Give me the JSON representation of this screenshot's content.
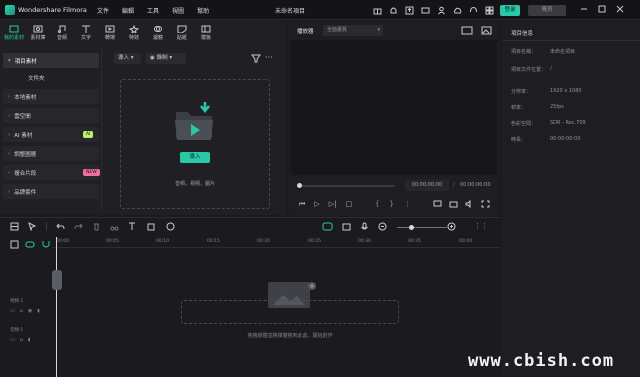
{
  "app_title": "Wondershare Filmora",
  "project_name": "未命名項目",
  "menu": [
    "文件",
    "編輯",
    "工具",
    "視圖",
    "幫助"
  ],
  "login_label": "登录",
  "buy_label": "購買",
  "tabs": [
    "我的素材",
    "素材庫",
    "音頻",
    "文字",
    "轉場",
    "特效",
    "濾鏡",
    "貼紙",
    "模板"
  ],
  "library": [
    {
      "label": "項目素材",
      "active": true
    },
    {
      "label": "文件夾",
      "plain": true
    },
    {
      "label": "本地素材"
    },
    {
      "label": "雲空間"
    },
    {
      "label": "AI 素材",
      "badge": "AI",
      "badge_color": "#b9f06a"
    },
    {
      "label": "調整圖層"
    },
    {
      "label": "複合片段",
      "badge": "NEW",
      "badge_color": "#f0709a"
    },
    {
      "label": "品牌套件"
    }
  ],
  "import_dropdown": "導入",
  "record_dropdown": "錄制",
  "import_button": "導入",
  "import_hint": "音頻，視頻，圖片",
  "preview": {
    "tab": "播放器",
    "quality": "全面畫質",
    "current_time": "00:00:00:00",
    "total_time": "00:00:00:00"
  },
  "properties": {
    "title": "項目信息",
    "rows": [
      {
        "label": "項目名稱：",
        "value": "未命名項目"
      },
      {
        "label": "項目文件位置：",
        "value": "/"
      },
      {
        "label": "分辨率：",
        "value": "1920 x 1080"
      },
      {
        "label": "幀率：",
        "value": "25fps"
      },
      {
        "label": "色彩空間：",
        "value": "SDR - Rec.709"
      },
      {
        "label": "時長：",
        "value": "00:00:00:00"
      }
    ]
  },
  "ruler": [
    "00:00",
    "00:05",
    "00:10",
    "00:15",
    "00:20",
    "00:25",
    "00:30",
    "00:35",
    "00:40"
  ],
  "tracks": [
    {
      "label": "視頻 1"
    },
    {
      "label": "音頻 1"
    }
  ],
  "timeline_hint": "拖拽媒體並將媒體拖到此處，開始創作",
  "watermark": "www.cbish.com"
}
